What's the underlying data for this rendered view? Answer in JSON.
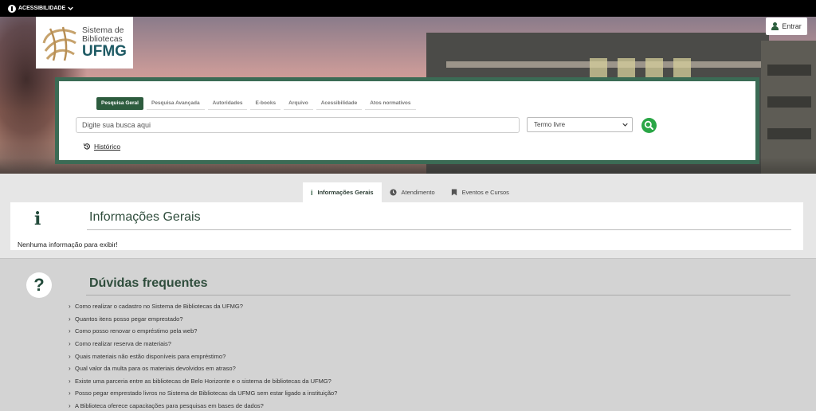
{
  "topbar": {
    "accessibility_label": "ACESSIBILIDADE"
  },
  "logo": {
    "line1": "Sistema de",
    "line2": "Bibliotecas",
    "brand": "UFMG"
  },
  "header": {
    "login_label": "Entrar"
  },
  "search": {
    "tabs": [
      {
        "label": "Pesquisa Geral",
        "active": true
      },
      {
        "label": "Pesquisa Avançada"
      },
      {
        "label": "Autoridades"
      },
      {
        "label": "E-books"
      },
      {
        "label": "Arquivo"
      },
      {
        "label": "Acessibilidade"
      },
      {
        "label": "Atos normativos"
      }
    ],
    "placeholder": "Digite sua busca aqui",
    "select_value": "Termo livre",
    "history_label": "Histórico"
  },
  "info_tabs": [
    {
      "label": "Informações Gerais",
      "icon": "info-icon",
      "active": true
    },
    {
      "label": "Atendimento",
      "icon": "clock-icon"
    },
    {
      "label": "Eventos e Cursos",
      "icon": "bookmark-icon"
    }
  ],
  "info": {
    "title": "Informações Gerais",
    "empty_text": "Nenhuma informação para exibir!"
  },
  "faq": {
    "title": "Dúvidas frequentes",
    "items": [
      "Como realizar o cadastro no Sistema de Bibliotecas da UFMG?",
      "Quantos itens posso pegar emprestado?",
      "Como posso renovar o empréstimo pela web?",
      "Como realizar reserva de materiais?",
      "Quais materiais não estão disponíveis para empréstimo?",
      "Qual valor da multa para os materiais devolvidos em atraso?",
      "Existe uma parceria entre as bibliotecas de Belo Horizonte e o sistema de bibliotecas da UFMG?",
      "Posso pegar emprestado livros no Sistema de Bibliotecas da UFMG sem estar ligado a instituição?",
      "A Biblioteca oferece capacitações para pesquisas em bases de dados?"
    ]
  },
  "colors": {
    "brand_green": "#2d5c3e",
    "search_button": "#2aa646",
    "logo_blue": "#1e5a64"
  }
}
